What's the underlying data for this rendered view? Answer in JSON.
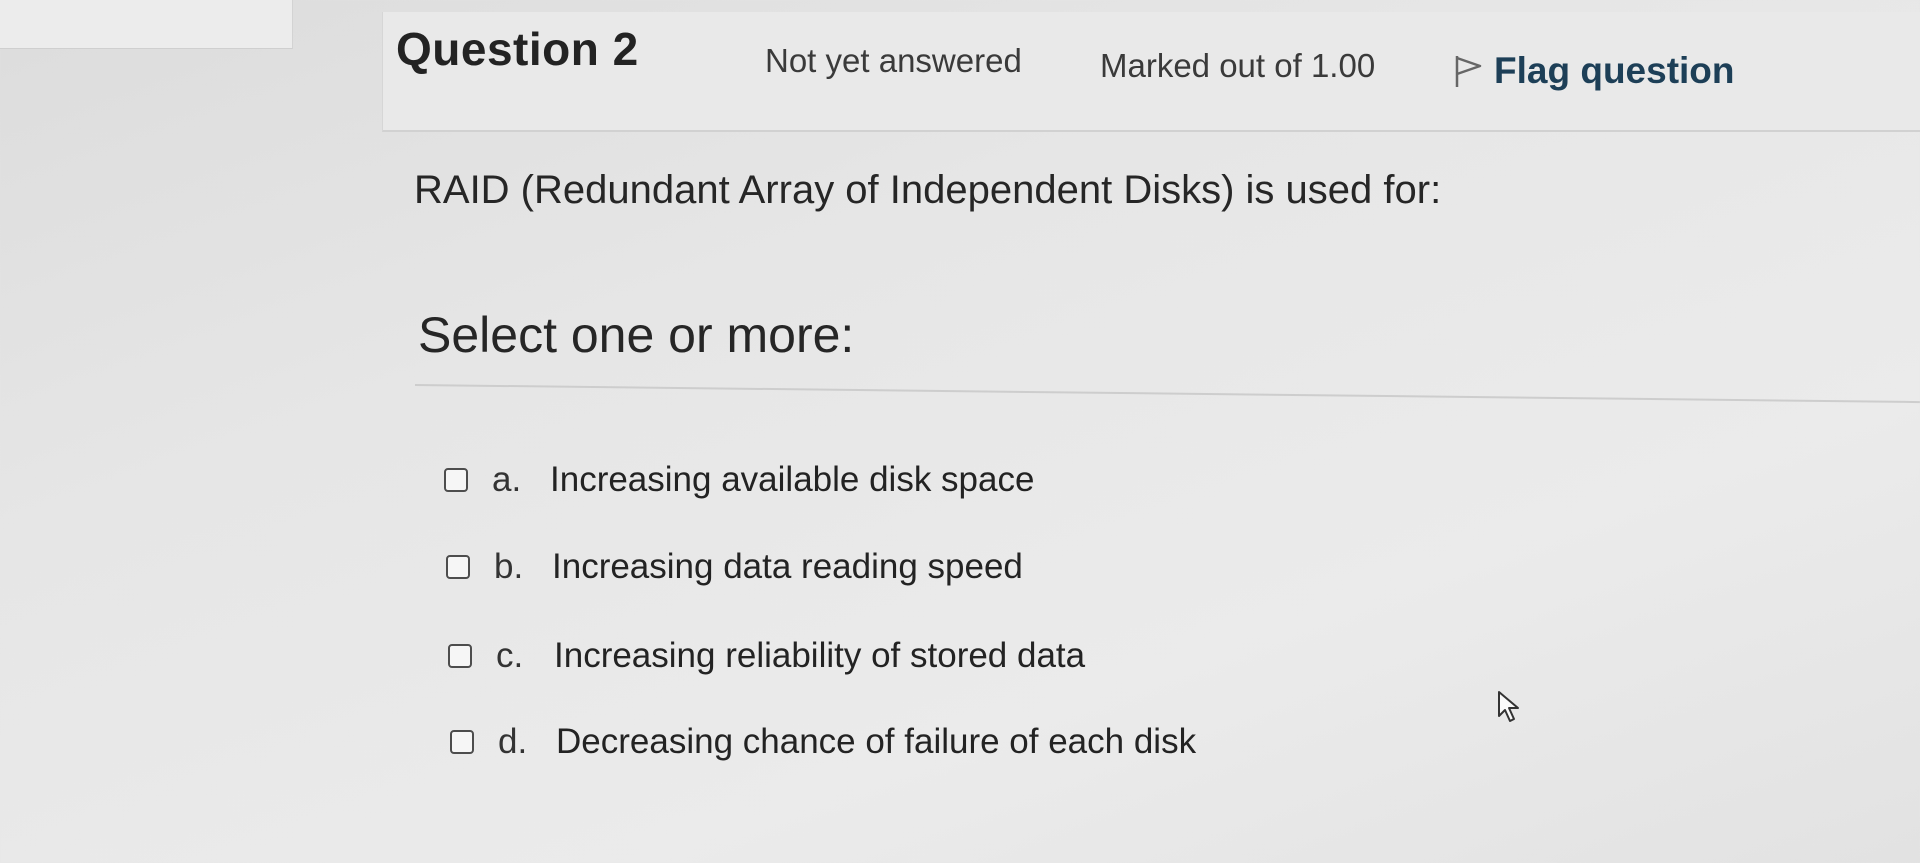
{
  "question": {
    "number_label": "Question 2",
    "state": "Not yet answered",
    "grade": "Marked out of 1.00",
    "flag_label": "Flag question",
    "text": "RAID (Redundant Array of Independent Disks) is used for:",
    "prompt": "Select one or more:"
  },
  "answers": [
    {
      "letter": "a.",
      "text": "Increasing available disk space",
      "checked": false
    },
    {
      "letter": "b.",
      "text": "Increasing data reading speed",
      "checked": false
    },
    {
      "letter": "c.",
      "text": "Increasing reliability of stored data",
      "checked": false
    },
    {
      "letter": "d.",
      "text": "Decreasing chance of failure of each disk",
      "checked": false
    }
  ],
  "icons": {
    "flag": "flag-icon",
    "cursor": "mouse-pointer-icon"
  },
  "colors": {
    "flag_link": "#1d3f57",
    "background": "#e6e6e6",
    "checkbox_border": "#4d4d4d"
  }
}
